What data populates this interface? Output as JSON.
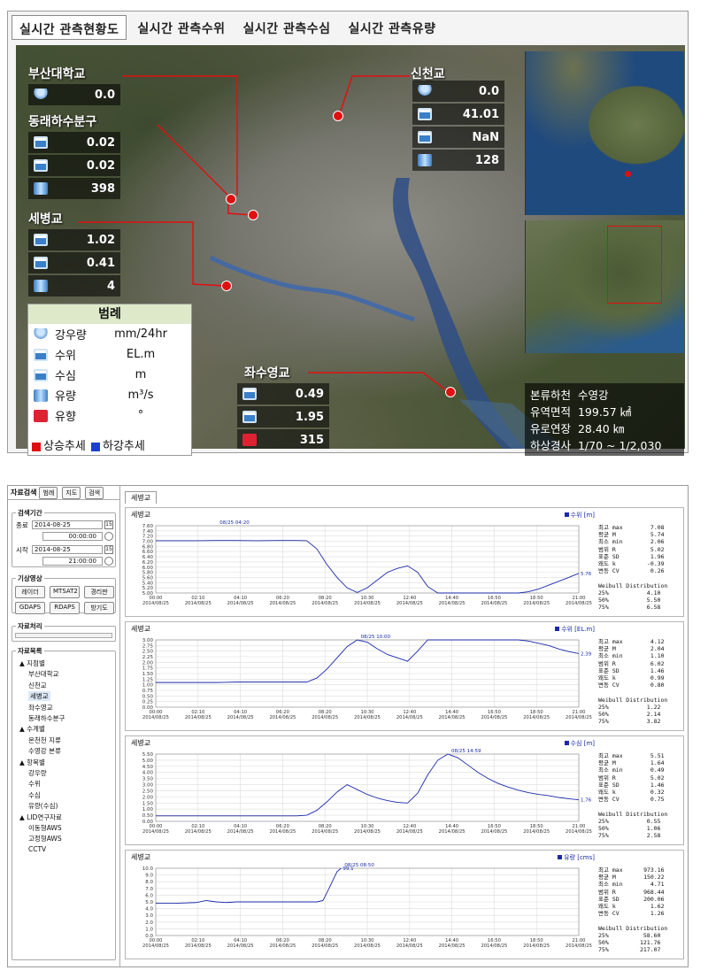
{
  "tabs": [
    "실시간 관측현황도",
    "실시간 관측수위",
    "실시간 관측수심",
    "실시간 관측유량"
  ],
  "sites": [
    {
      "name": "부산대학교",
      "values": [
        {
          "icon": "rain-icon",
          "value": "0.0"
        }
      ]
    },
    {
      "name": "동래하수분구",
      "values": [
        {
          "icon": "water-level-icon",
          "value": "0.02"
        },
        {
          "icon": "water-depth-icon",
          "value": "0.02"
        },
        {
          "icon": "flow-icon",
          "value": "398"
        }
      ]
    },
    {
      "name": "세병교",
      "values": [
        {
          "icon": "water-level-icon",
          "value": "1.02"
        },
        {
          "icon": "water-depth-icon",
          "value": "0.41"
        },
        {
          "icon": "flow-icon",
          "value": "4"
        }
      ]
    },
    {
      "name": "신천교",
      "values": [
        {
          "icon": "rain-icon",
          "value": "0.0"
        },
        {
          "icon": "water-level-icon",
          "value": "41.01"
        },
        {
          "icon": "water-depth-icon",
          "value": "NaN"
        },
        {
          "icon": "flow-icon",
          "value": "128"
        }
      ]
    },
    {
      "name": "좌수영교",
      "values": [
        {
          "icon": "water-level-icon",
          "value": "0.49"
        },
        {
          "icon": "water-depth-icon",
          "value": "1.95"
        },
        {
          "icon": "flow-direction-icon",
          "value": "315"
        }
      ]
    }
  ],
  "legend": {
    "title": "범례",
    "items": [
      {
        "name": "강우량",
        "unit": "mm/24hr"
      },
      {
        "name": "수위",
        "unit": "EL.m"
      },
      {
        "name": "수심",
        "unit": "m"
      },
      {
        "name": "유량",
        "unit": "m³/s"
      },
      {
        "name": "유향",
        "unit": "°"
      }
    ],
    "up_label": "상승추세",
    "down_label": "하강추세",
    "up_color": "#e01010",
    "down_color": "#1a3fd0"
  },
  "info": {
    "rows": [
      {
        "k": "본류하천",
        "v": "수영강"
      },
      {
        "k": "유역면적",
        "v": "199.57 ㎢"
      },
      {
        "k": "유로연장",
        "v": "28.40 ㎞"
      },
      {
        "k": "하상경사",
        "v": "1/70 ~ 1/2,030"
      }
    ]
  },
  "sidebar": {
    "title_tab": "자료검색",
    "small_tabs": [
      "범례",
      "지도",
      "검색"
    ],
    "period_title": "검색기간",
    "end_label": "종료",
    "end_date": "2014-08-25",
    "end_time": "00:00:00",
    "start_label": "시작",
    "start_date": "2014-08-25",
    "start_time": "21:00:00",
    "weather_title": "기상영상",
    "weather_buttons": [
      "레이더",
      "MTSAT2",
      "경리판",
      "GDAPS",
      "RDAPS",
      "방기도"
    ],
    "process_title": "자료처리",
    "list_title": "자료목록",
    "tree": [
      {
        "level": 1,
        "label": "▲ 지점별"
      },
      {
        "level": 2,
        "label": "부산대학교"
      },
      {
        "level": 2,
        "label": "신천교"
      },
      {
        "level": 2,
        "label": "세병교"
      },
      {
        "level": 2,
        "label": "좌수영교"
      },
      {
        "level": 2,
        "label": "동래하수분구"
      },
      {
        "level": 1,
        "label": "▲ 수계별"
      },
      {
        "level": 2,
        "label": "온천천 지류"
      },
      {
        "level": 2,
        "label": "수영강 본류"
      },
      {
        "level": 1,
        "label": "▲ 항목별"
      },
      {
        "level": 2,
        "label": "강우량"
      },
      {
        "level": 2,
        "label": "수위"
      },
      {
        "level": 2,
        "label": "수심"
      },
      {
        "level": 2,
        "label": "유량(수심)"
      },
      {
        "level": 1,
        "label": "▲ LID연구자료"
      },
      {
        "level": 2,
        "label": "이동형AWS"
      },
      {
        "level": 2,
        "label": "고정형AWS"
      },
      {
        "level": 2,
        "label": "CCTV"
      }
    ]
  },
  "main": {
    "tab": "세병교"
  },
  "x_labels": [
    "00:00\n2014/08/25",
    "02:10\n2014/08/25",
    "04:10\n2014/08/25",
    "06:20\n2014/08/25",
    "08:20\n2014/08/25",
    "10:30\n2014/08/25",
    "12:40\n2014/08/25",
    "14:40\n2014/08/25",
    "16:50\n2014/08/25",
    "18:50\n2014/08/25",
    "21:00\n2014/08/25"
  ],
  "stat_labels": [
    "최고 max",
    "평균 M",
    "최소 min",
    "범위 R",
    "표준 SD",
    "왜도 k",
    "변동 CV"
  ],
  "chart_data": [
    {
      "type": "line",
      "title": "세병교",
      "legend": "수위 [m]",
      "ylim": [
        5.0,
        7.6
      ],
      "yticks": [
        "7.60",
        "7.40",
        "7.20",
        "7.00",
        "6.80",
        "6.60",
        "6.40",
        "6.20",
        "6.00",
        "5.80",
        "5.60",
        "5.40",
        "5.20",
        "5.00"
      ],
      "x": [
        0,
        0.3,
        1,
        2,
        3,
        4,
        5,
        6,
        7,
        7.5,
        8,
        8.5,
        9,
        9.5,
        10,
        10.5,
        11,
        11.5,
        12,
        12.5,
        13,
        13.5,
        14,
        14.5,
        15,
        15.5,
        16,
        16.5,
        17,
        17.5,
        18,
        18.5,
        19,
        19.5,
        20,
        20.5,
        21
      ],
      "y": [
        7.02,
        7.02,
        7.02,
        7.02,
        7.03,
        7.03,
        7.02,
        7.03,
        7.03,
        7.02,
        6.7,
        6.1,
        5.6,
        5.2,
        5.02,
        5.2,
        5.5,
        5.8,
        5.95,
        6.05,
        5.8,
        5.25,
        5.0,
        5.0,
        5.0,
        5.0,
        5.0,
        5.0,
        5.0,
        5.0,
        5.0,
        5.05,
        5.15,
        5.3,
        5.45,
        5.6,
        5.76
      ],
      "peak_label": "08/25 04:20",
      "end_label": "5.76",
      "stats": [
        "7.08",
        "5.74",
        "2.06",
        "5.02",
        "1.96",
        "-0.39",
        "0.26"
      ],
      "weibull": {
        "title": "Weibull Distribution",
        "rows": [
          [
            "25%",
            "4.10"
          ],
          [
            "50%",
            "5.50"
          ],
          [
            "75%",
            "6.58"
          ]
        ]
      }
    },
    {
      "type": "line",
      "title": "세병교",
      "legend": "수위 [EL.m]",
      "ylim": [
        0,
        3.0
      ],
      "yticks": [
        "3.00",
        "2.75",
        "2.50",
        "2.25",
        "2.00",
        "1.75",
        "1.50",
        "1.25",
        "1.00",
        "0.75",
        "0.50",
        "0.25",
        "0.00"
      ],
      "x": [
        0,
        1,
        2,
        3,
        4,
        5,
        6,
        7,
        7.5,
        8,
        8.5,
        9,
        9.5,
        10,
        10.5,
        11,
        11.5,
        12,
        12.5,
        13,
        13.5,
        14,
        14.5,
        15,
        15.5,
        16,
        16.5,
        17,
        17.5,
        18,
        18.5,
        19,
        19.5,
        20,
        20.5,
        21
      ],
      "y": [
        1.1,
        1.1,
        1.1,
        1.1,
        1.12,
        1.12,
        1.12,
        1.12,
        1.12,
        1.3,
        1.7,
        2.2,
        2.7,
        3.0,
        2.9,
        2.6,
        2.35,
        2.2,
        2.05,
        2.5,
        3.0,
        3.0,
        3.0,
        3.0,
        3.0,
        3.0,
        3.0,
        3.0,
        3.0,
        3.0,
        2.95,
        2.85,
        2.75,
        2.6,
        2.48,
        2.39
      ],
      "peak_label": "08/25 10:00",
      "end_label": "2.39",
      "stats": [
        "4.12",
        "2.04",
        "1.10",
        "6.02",
        "1.46",
        "0.99",
        "0.80"
      ],
      "weibull": {
        "title": "Weibull Distribution",
        "rows": [
          [
            "25%",
            "1.22"
          ],
          [
            "50%",
            "2.14"
          ],
          [
            "75%",
            "3.82"
          ]
        ]
      }
    },
    {
      "type": "line",
      "title": "세병교",
      "legend": "수심 [m]",
      "ylim": [
        0,
        5.5
      ],
      "yticks": [
        "5.50",
        "5.00",
        "4.50",
        "4.00",
        "3.50",
        "3.00",
        "2.50",
        "2.00",
        "1.50",
        "1.00",
        "0.50",
        "0.00"
      ],
      "x": [
        0,
        1,
        2,
        3,
        4,
        5,
        6,
        7,
        7.5,
        8,
        8.5,
        9,
        9.5,
        10,
        10.5,
        11,
        11.5,
        12,
        12.5,
        13,
        13.5,
        14,
        14.5,
        15,
        15.5,
        16,
        16.5,
        17,
        17.5,
        18,
        18.5,
        19,
        19.5,
        20,
        20.5,
        21
      ],
      "y": [
        0.45,
        0.45,
        0.45,
        0.45,
        0.45,
        0.45,
        0.45,
        0.45,
        0.5,
        0.9,
        1.6,
        2.4,
        3.0,
        2.6,
        2.2,
        1.9,
        1.7,
        1.55,
        1.5,
        2.3,
        3.8,
        5.0,
        5.5,
        5.2,
        4.6,
        4.0,
        3.5,
        3.1,
        2.8,
        2.55,
        2.35,
        2.2,
        2.1,
        1.95,
        1.85,
        1.76
      ],
      "peak_label": "08/25 14:59",
      "end_label": "1.76",
      "stats": [
        "5.51",
        "1.64",
        "0.49",
        "5.02",
        "1.46",
        "0.32",
        "0.75"
      ],
      "weibull": {
        "title": "Weibull Distribution",
        "rows": [
          [
            "25%",
            "0.55"
          ],
          [
            "50%",
            "1.06"
          ],
          [
            "75%",
            "2.58"
          ]
        ]
      }
    },
    {
      "type": "line",
      "title": "세병교",
      "legend": "유량 [cms]",
      "ylim": [
        0,
        10.0
      ],
      "yticks": [
        "10.0",
        "9.0",
        "8.0",
        "7.0",
        "6.0",
        "5.0",
        "4.0",
        "3.0",
        "2.0",
        "1.0",
        "0.0"
      ],
      "x": [
        0,
        1,
        2,
        2.5,
        3,
        3.5,
        4,
        5,
        6,
        7,
        7.5,
        8,
        8.3,
        8.6,
        9,
        9.2
      ],
      "y": [
        4.8,
        4.8,
        4.9,
        5.2,
        5.0,
        4.9,
        5.0,
        5.0,
        5.0,
        5.0,
        5.0,
        5.0,
        5.2,
        7.0,
        9.5,
        10.0
      ],
      "peak_label": "08/25 08:50",
      "end_label": "99.1",
      "stats": [
        "973.16",
        "150.22",
        "4.71",
        "968.44",
        "200.06",
        "1.62",
        "1.26"
      ],
      "weibull": {
        "title": "Weibull Distribution",
        "rows": [
          [
            "25%",
            "58.60"
          ],
          [
            "50%",
            "121.76"
          ],
          [
            "75%",
            "217.07"
          ]
        ]
      }
    }
  ]
}
